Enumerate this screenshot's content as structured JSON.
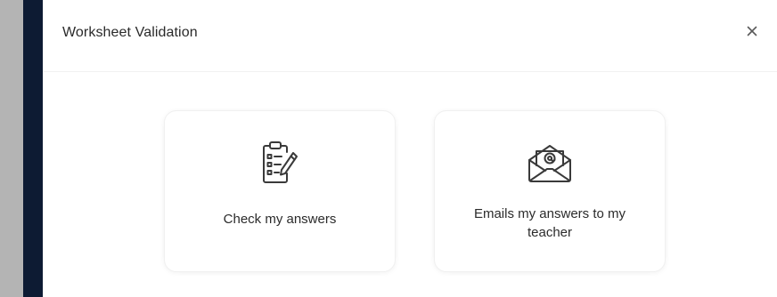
{
  "dialog": {
    "title": "Worksheet Validation",
    "close_icon": "close-icon"
  },
  "options": [
    {
      "label": "Check my answers",
      "icon": "clipboard-checklist-icon"
    },
    {
      "label": "Emails my answers to my teacher",
      "icon": "email-envelope-icon"
    }
  ],
  "colors": {
    "left_edge_gray": "#b4b4b4",
    "left_edge_navy": "#0d1b33",
    "text": "#2b2b2b",
    "icon_stroke": "#3a3a3a"
  }
}
